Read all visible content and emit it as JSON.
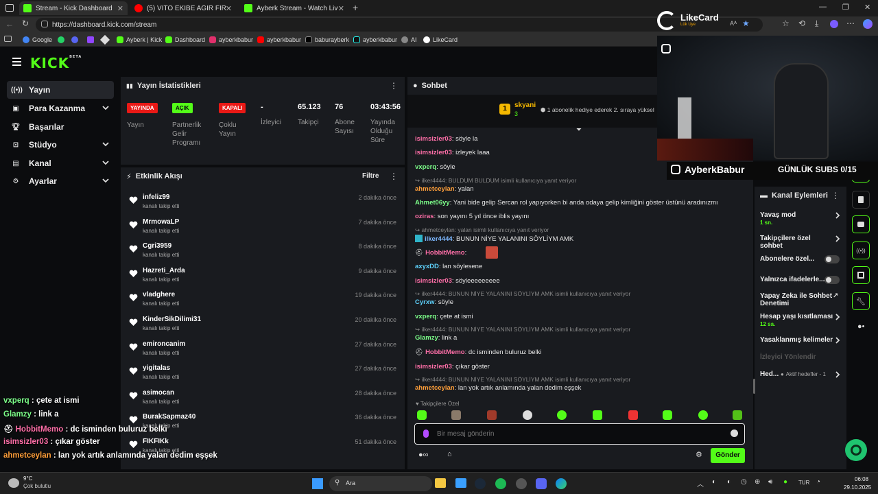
{
  "browser": {
    "tabs": [
      {
        "title": "Stream - Kick Dashboard",
        "color": "#53fc18"
      },
      {
        "title": "(5) VİTO EKİBE AĞIR FIRÇA ATIYOR",
        "color": "#ff0000"
      },
      {
        "title": "Ayberk Stream - Watch Live on Kick",
        "color": "#53fc18"
      }
    ],
    "url": "https://dashboard.kick.com/stream",
    "bookmarks": [
      "Google",
      "Ayberk | Kick",
      "Dashboard",
      "ayberkbabur",
      "ayberkbabur",
      "baburayberk",
      "ayberkbabur",
      "AI",
      "LikeCard"
    ],
    "likecard": {
      "name": "LikeCard",
      "sub": "Lük Uye"
    }
  },
  "sidebar": {
    "items": [
      {
        "label": "Yayın",
        "icon": "broadcast-icon"
      },
      {
        "label": "Para Kazanma",
        "icon": "money-icon"
      },
      {
        "label": "Başarılar",
        "icon": "trophy-icon"
      },
      {
        "label": "Stüdyo",
        "icon": "studio-icon"
      },
      {
        "label": "Kanal",
        "icon": "user-icon"
      },
      {
        "label": "Ayarlar",
        "icon": "gear-icon"
      }
    ]
  },
  "stats": {
    "title": "Yayın İstatistikleri",
    "cells": [
      {
        "badge": "YAYINDA",
        "label": "Yayın"
      },
      {
        "badge": "AÇIK",
        "label": "Partnerlik Gelir Programı"
      },
      {
        "badge": "KAPALI",
        "label": "Çoklu Yayın"
      },
      {
        "value": "-",
        "label": "İzleyici"
      },
      {
        "value": "65.123",
        "label": "Takipçi"
      },
      {
        "value": "76",
        "label": "Abone Sayısı"
      },
      {
        "value": "03:43:56",
        "label": "Yayında Olduğu Süre"
      }
    ]
  },
  "activity": {
    "title": "Etkinlik Akışı",
    "filter": "Filtre",
    "items": [
      {
        "user": "infeliz99",
        "action": "kanalı takip etti",
        "time": "2 dakika önce"
      },
      {
        "user": "MrmowaLP",
        "action": "kanalı takip etti",
        "time": "7 dakika önce"
      },
      {
        "user": "Cgri3959",
        "action": "kanalı takip etti",
        "time": "8 dakika önce"
      },
      {
        "user": "Hazreti_Arda",
        "action": "kanalı takip etti",
        "time": "9 dakika önce"
      },
      {
        "user": "vladghere",
        "action": "kanalı takip etti",
        "time": "19 dakika önce"
      },
      {
        "user": "KinderSikDilimi31",
        "action": "kanalı takip etti",
        "time": "20 dakika önce"
      },
      {
        "user": "emironcanim",
        "action": "kanalı takip etti",
        "time": "27 dakika önce"
      },
      {
        "user": "yigitalas",
        "action": "kanalı takip etti",
        "time": "27 dakika önce"
      },
      {
        "user": "asimocan",
        "action": "kanalı takip etti",
        "time": "28 dakika önce"
      },
      {
        "user": "BurakSapmaz40",
        "action": "kanalı takip etti",
        "time": "36 dakika önce"
      },
      {
        "user": "FIKFIKk",
        "action": "kanalı takip etti",
        "time": "51 dakika önce"
      }
    ]
  },
  "chat": {
    "title": "Sohbet",
    "pinned": {
      "rank": "1",
      "user": "skyani",
      "count": "3",
      "text": "1 abonelik hediye ederek 2. sıraya yüksel"
    },
    "lines": [
      {
        "type": "msg",
        "user": "isimsizler03",
        "color": "#ff6fa8",
        "text": ": söyle la"
      },
      {
        "type": "msg",
        "user": "isimsizler03",
        "color": "#ff6fa8",
        "text": ": izleyek laaa"
      },
      {
        "type": "msg",
        "user": "vxperq",
        "color": "#7dff8a",
        "text": ": söyle"
      },
      {
        "type": "reply",
        "text": "ilker4444: BULDUM BULDUM isimli kullanıcıya yanıt veriyor"
      },
      {
        "type": "msg",
        "user": "ahmetceylan",
        "color": "#ff9f3a",
        "text": ": yalan"
      },
      {
        "type": "msg",
        "user": "Ahmet06yy",
        "color": "#7dff8a",
        "text": ": Yani bide gelip Sercan rol yapıyorken bi anda odaya gelip kimliğini göster üstünü aradınızmı"
      },
      {
        "type": "msg",
        "user": "oziras",
        "color": "#ff6fa8",
        "text": ": son yayını 5 yıl önce iblis yayını"
      },
      {
        "type": "reply",
        "text": "ahmetceylan: yalan isimli kullanıcıya yanıt veriyor"
      },
      {
        "type": "msg",
        "user": "ilker4444",
        "color": "#7db8ff",
        "text": ": BUNUN NİYE YALANINI SÖYLİYM AMK"
      },
      {
        "type": "msg",
        "user": "HobbitMemo",
        "color": "#ff6fa8",
        "text": ":"
      },
      {
        "type": "msg",
        "user": "axyxDD",
        "color": "#5fd4ff",
        "text": ": lan söylesene"
      },
      {
        "type": "msg",
        "user": "isimsizler03",
        "color": "#ff6fa8",
        "text": ": söyleeeeeeeee"
      },
      {
        "type": "reply",
        "text": "ilker4444: BUNUN NİYE YALANINI SÖYLİYM AMK isimli kullanıcıya yanıt veriyor"
      },
      {
        "type": "msg",
        "user": "Cyrxw",
        "color": "#5fd4ff",
        "text": ": söyle"
      },
      {
        "type": "msg",
        "user": "vxperq",
        "color": "#7dff8a",
        "text": ": çete at ismi"
      },
      {
        "type": "reply",
        "text": "ilker4444: BUNUN NİYE YALANINI SÖYLİYM AMK isimli kullanıcıya yanıt veriyor"
      },
      {
        "type": "msg",
        "user": "Glamzy",
        "color": "#7dff8a",
        "text": ": link a"
      },
      {
        "type": "msg",
        "user": "HobbitMemo",
        "color": "#ff6fa8",
        "text": ": dc isminden buluruz belki"
      },
      {
        "type": "msg",
        "user": "isimsizler03",
        "color": "#ff6fa8",
        "text": ": çıkar göster"
      },
      {
        "type": "reply",
        "text": "ilker4444: BUNUN NİYE YALANINI SÖYLİYM AMK isimli kullanıcıya yanıt veriyor"
      },
      {
        "type": "msg",
        "user": "ahmetceylan",
        "color": "#ff9f3a",
        "text": ": lan yok artık anlamında yalan dedim eşşek"
      }
    ],
    "followers_only": "Takipçilere Özel",
    "placeholder": "Bir mesaj gönderin",
    "send": "Gönder"
  },
  "channel_actions": {
    "title": "Kanal Eylemleri",
    "items": [
      {
        "label": "Yavaş mod",
        "sub": "1 sn."
      },
      {
        "label": "Takipçilere özel sohbet"
      },
      {
        "label": "Abonelere özel..."
      },
      {
        "label": "Yalnızca ifadelerle..."
      },
      {
        "label": "Yapay Zeka ile Sohbet Denetimi"
      },
      {
        "label": "Hesap yaşı kısıtlaması",
        "sub": "12 sa."
      },
      {
        "label": "Yasaklanmış kelimeler"
      },
      {
        "label": "İzleyici Yönlendir"
      },
      {
        "label": "Hed...",
        "sub": "Aktif hedefler - 1"
      }
    ]
  },
  "webcam": {
    "handle": "AyberkBabur",
    "subs": "GÜNLÜK SUBS 0/15"
  },
  "overlay_chat": [
    {
      "user": "vxperq",
      "color": "#7dff8a",
      "text": " : çete at ismi"
    },
    {
      "user": "Glamzy",
      "color": "#7dff8a",
      "text": " : link a"
    },
    {
      "user": "HobbitMemo",
      "color": "#ff6fa8",
      "text": " : dc isminden buluruz belki"
    },
    {
      "user": "isimsizler03",
      "color": "#ff6fa8",
      "text": " : çıkar göster"
    },
    {
      "user": "ahmetceylan",
      "color": "#ff9f3a",
      "text": " : lan yok artık anlamında yalan dedim eşşek"
    }
  ],
  "taskbar": {
    "weather_temp": "9°C",
    "weather_desc": "Çok bulutlu",
    "search": "Ara",
    "lang": "TUR",
    "time": "06:08",
    "date": "29.10.2025"
  }
}
